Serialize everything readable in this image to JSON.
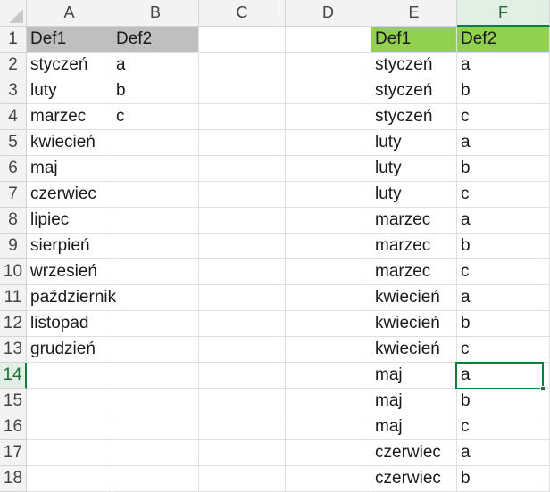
{
  "columns": [
    "A",
    "B",
    "C",
    "D",
    "E",
    "F"
  ],
  "active_column": "F",
  "rows": [
    "1",
    "2",
    "3",
    "4",
    "5",
    "6",
    "7",
    "8",
    "9",
    "10",
    "11",
    "12",
    "13",
    "14",
    "15",
    "16",
    "17",
    "18"
  ],
  "active_row": "14",
  "header_colors": {
    "left_table": "#bfbfbf",
    "right_table": "#92d050",
    "selection": "#107c41"
  },
  "cells": {
    "A1": "Def1",
    "B1": "Def2",
    "E1": "Def1",
    "F1": "Def2",
    "A2": "styczeń",
    "B2": "a",
    "E2": "styczeń",
    "F2": "a",
    "A3": "luty",
    "B3": "b",
    "E3": "styczeń",
    "F3": "b",
    "A4": "marzec",
    "B4": "c",
    "E4": "styczeń",
    "F4": "c",
    "A5": "kwiecień",
    "E5": "luty",
    "F5": "a",
    "A6": "maj",
    "E6": "luty",
    "F6": "b",
    "A7": "czerwiec",
    "E7": "luty",
    "F7": "c",
    "A8": "lipiec",
    "E8": "marzec",
    "F8": "a",
    "A9": "sierpień",
    "E9": "marzec",
    "F9": "b",
    "A10": "wrzesień",
    "E10": "marzec",
    "F10": "c",
    "A11": "październik",
    "E11": "kwiecień",
    "F11": "a",
    "A12": "listopad",
    "E12": "kwiecień",
    "F12": "b",
    "A13": "grudzień",
    "E13": "kwiecień",
    "F13": "c",
    "E14": "maj",
    "F14": "a",
    "E15": "maj",
    "F15": "b",
    "E16": "maj",
    "F16": "c",
    "E17": "czerwiec",
    "F17": "a",
    "E18": "czerwiec",
    "F18": "b"
  }
}
